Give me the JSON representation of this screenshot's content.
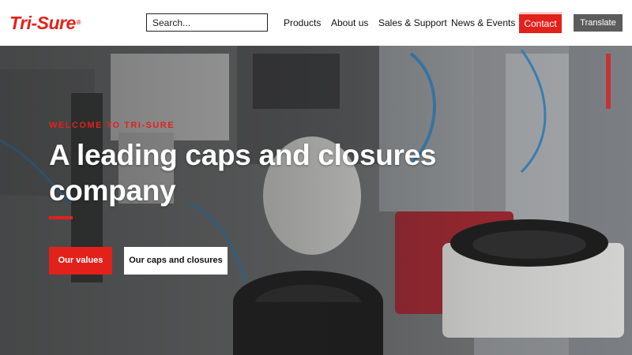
{
  "header": {
    "logo_text": "Tri-Sure",
    "logo_mark": "®",
    "search": {
      "placeholder": "Search..."
    },
    "nav": [
      {
        "label": "Products"
      },
      {
        "label": "About us"
      },
      {
        "label": "Sales & Support"
      },
      {
        "label": "News & Events"
      }
    ],
    "contact_label": "Contact",
    "translate_label": "Translate"
  },
  "hero": {
    "eyebrow": "WELCOME TO TRI-SURE",
    "headline": "A leading caps and closures company",
    "primary_cta": "Our values",
    "secondary_cta": "Our caps and closures"
  },
  "colors": {
    "brand_red": "#e3211b",
    "translate_grey": "#5c5c5c"
  }
}
